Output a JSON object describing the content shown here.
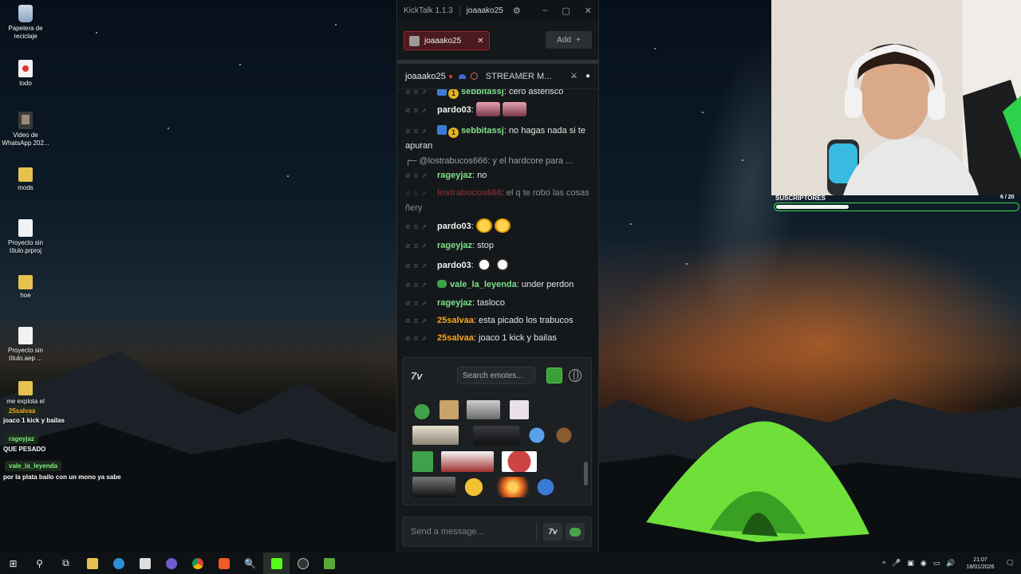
{
  "desktop": {
    "icons": [
      {
        "label": "Papelera de reciclaje"
      },
      {
        "label": "todo"
      },
      {
        "label": "Video de WhatsApp 202..."
      },
      {
        "label": "mods"
      },
      {
        "label": "Proyecto sin título.prproj"
      },
      {
        "label": "hoe"
      },
      {
        "label": "Proyecto sin título.aep ..."
      },
      {
        "label": "me explota el"
      }
    ]
  },
  "overlay_chat": {
    "user1": "25salvaa",
    "msg1": "joaco 1 kick y bailas",
    "user2": "rageyjaz",
    "msg2": "QUE PESADO",
    "user3": "vale_la_leyenda",
    "msg3": "por la plata bailo con un mono ya sabe"
  },
  "kicktalk": {
    "title": "KickTalk 1.1.3",
    "title_user": "joaaako25",
    "tab_label": "joaaako25",
    "add_label": "Add",
    "header_channel": "joaaako25",
    "header_mode": "STREAMER M...",
    "messages": [
      {
        "user": "sebbitassj",
        "text": "cero asterisco"
      },
      {
        "user": "pardo03",
        "text": ""
      },
      {
        "user": "sebbitassj",
        "text": "no hagas nada si te apuran"
      },
      {
        "user": "@lostrabucos666",
        "text": "y el hardcore para ..."
      },
      {
        "user": "rageyjaz",
        "text": "no"
      },
      {
        "user": "lostrabucos666",
        "text": "el q te robo las cosas ñery"
      },
      {
        "user": "pardo03",
        "text": ""
      },
      {
        "user": "rageyjaz",
        "text": "stop"
      },
      {
        "user": "pardo03",
        "text": ""
      },
      {
        "user": "vale_la_leyenda",
        "text": "under perdon"
      },
      {
        "user": "rageyjaz",
        "text": "tasloco"
      },
      {
        "user": "25salvaa",
        "text": "esta picado los trabucos"
      },
      {
        "user": "25salvaa",
        "text": "joaco 1 kick y bailas"
      }
    ],
    "emote_search_placeholder": "Search emotes...",
    "message_placeholder": "Send a message...",
    "seven_tv": "7v"
  },
  "stream": {
    "sub_label": "SUSCRIPTORES",
    "sub_count": "6 / 20",
    "sub_progress": 0.3
  },
  "taskbar": {
    "time": "21:07",
    "date": "18/01/2026"
  }
}
